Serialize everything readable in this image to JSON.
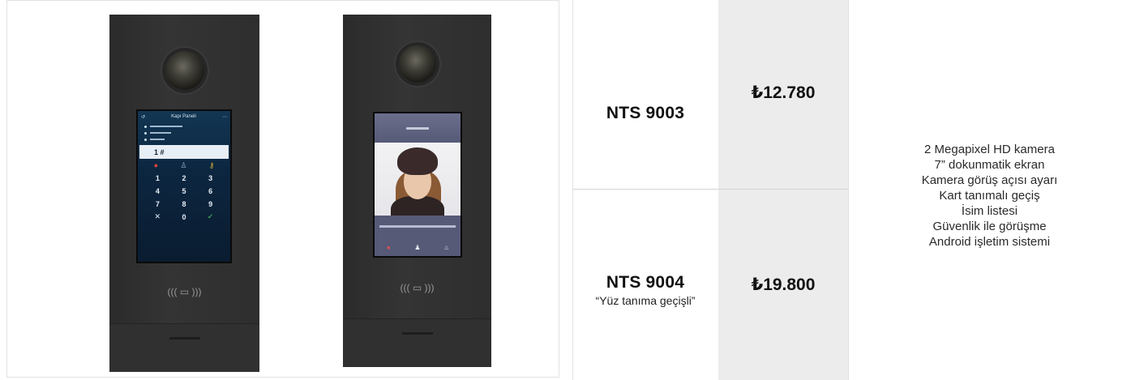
{
  "device_1": {
    "screen_title": "Kapı Paneli",
    "entry_value": "1 #",
    "keys": [
      "1",
      "2",
      "3",
      "4",
      "5",
      "6",
      "7",
      "8",
      "9",
      "✕",
      "0",
      "✓"
    ]
  },
  "products": [
    {
      "model": "NTS 9003",
      "subtitle": "",
      "price": "₺12.780"
    },
    {
      "model": "NTS 9004",
      "subtitle": "“Yüz tanıma geçişli”",
      "price": "₺19.800"
    }
  ],
  "features": [
    "2 Megapixel HD kamera",
    "7” dokunmatik ekran",
    "Kamera görüş açısı ayarı",
    "Kart tanımalı geçiş",
    "İsim listesi",
    "Güvenlik ile görüşme",
    "Android işletim sistemi"
  ],
  "colors": {
    "price_column_bg": "#ececec",
    "device_body": "#2e2e2e",
    "text": "#111111"
  }
}
